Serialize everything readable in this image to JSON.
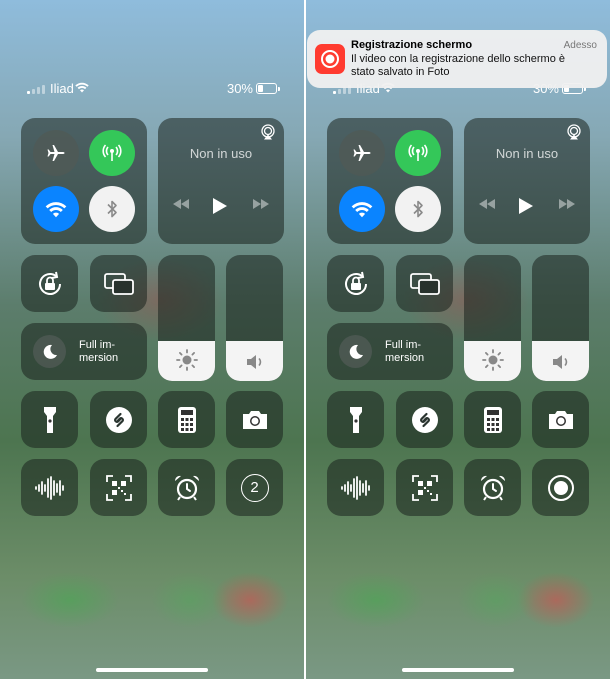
{
  "status_bar": {
    "carrier": "Iliad",
    "battery": "30%"
  },
  "media": {
    "status": "Non in uso"
  },
  "focus": {
    "label": "Full im-\nmersion"
  },
  "sliders": {
    "brightness_level": 0.32,
    "volume_level": 0.32
  },
  "timer_badge": "2",
  "notification": {
    "app": "Registrazione schermo",
    "time": "Adesso",
    "body": "Il video con la registrazione dello schermo è stato salvato in Foto"
  },
  "colors": {
    "cellular": "#34c759",
    "wifi_active": "#0a84ff",
    "record_app": "#ff3b30"
  },
  "icons": {
    "connectivity": [
      "airplane-icon",
      "cellular-data-icon",
      "wifi-icon",
      "bluetooth-icon"
    ],
    "row2": [
      "orientation-lock-icon",
      "screen-mirroring-icon"
    ],
    "row4": [
      "flashlight-icon",
      "shazam-icon",
      "calculator-icon",
      "camera-icon"
    ],
    "row5_left": [
      "voice-memo-icon",
      "qr-scanner-icon",
      "alarm-icon",
      "timer-icon"
    ],
    "row5_right": [
      "voice-memo-icon",
      "qr-scanner-icon",
      "alarm-icon",
      "screen-record-icon"
    ]
  }
}
